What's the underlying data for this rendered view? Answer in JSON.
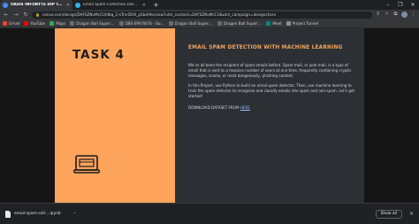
{
  "browser": {
    "tabs": [
      {
        "title": "OASIS INFOBYTE DIP TASK LIST",
        "favicon_color": "#4b8cf5",
        "active": true
      },
      {
        "title": "Email Spam Collection Dataset | Kag...",
        "favicon_color": "#2fb4e0",
        "active": false
      }
    ],
    "new_tab": "+",
    "window_controls": {
      "minimize": "–",
      "maximize": "❐",
      "close": "✕"
    },
    "url": "canva.com/design/DAFSZNvMcCU/dbq_2-xTrnrDHX_p5bdr9o/view?utm_content=DAFSZNvMcCU&utm_campaign=designshare",
    "bookmarks": [
      {
        "label": "Gmail",
        "color": "#ea4335"
      },
      {
        "label": "YouTube",
        "color": "#ff0000"
      },
      {
        "label": "Maps",
        "color": "#34a853"
      },
      {
        "label": "Dragon Ball Super:...",
        "color": "#6b6b6b"
      },
      {
        "label": "DBS EP478/76 - Go...",
        "color": "#6b6b6b"
      },
      {
        "label": "Dragon Ball Super:...",
        "color": "#6b6b6b"
      },
      {
        "label": "Dragon Ball Super:...",
        "color": "#6b6b6b"
      },
      {
        "label": "Meet",
        "color": "#00897b"
      },
      {
        "label": "Project Tunnel",
        "color": "#8e8e8e"
      }
    ]
  },
  "slide": {
    "task_label": "TASK 4",
    "headline": "EMAIL SPAM DETECTION WITH MACHINE LEARNING",
    "paragraph_1": "We've all been the recipient of spam emails before. Spam mail, or junk mail, is a type of email that is sent to a massive number of users at one time, frequently containing cryptic messages, scams, or most dangerously, phishing content.",
    "paragraph_2": "In this Project, use Python to build an email spam detector. Then, use machine learning to train the spam detector to recognize and classify emails into spam and non-spam. Let's get started!",
    "download_text": "DOWNLOAD DATASET FROM",
    "download_link": "HERE",
    "accent_color": "#ffa45c"
  },
  "download_bar": {
    "file_name": "email-spam-coll....ipynb",
    "show_all": "Show all",
    "close": "✕"
  }
}
